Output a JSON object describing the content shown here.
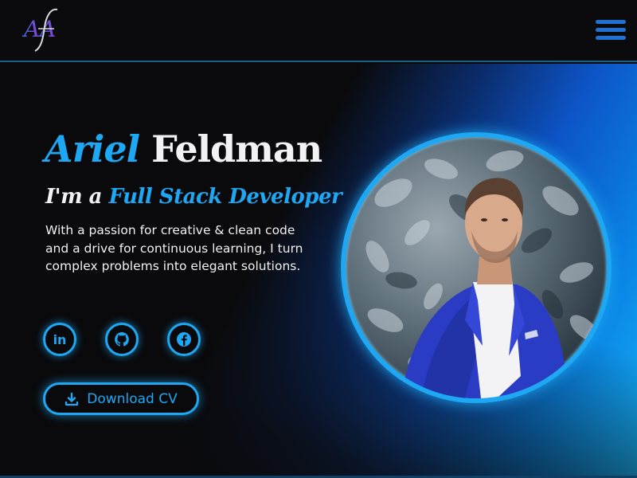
{
  "header": {
    "logo_text": "AF",
    "menu_icon": "hamburger-menu-icon",
    "accent_color": "#1e72d6"
  },
  "hero": {
    "first_name": "Ariel",
    "last_name": "Feldman",
    "role_lead": "I'm a",
    "role_highlight": "Full Stack Developer",
    "bio": "With a passion for creative & clean code and a drive for continuous learning, I turn complex problems into elegant solutions.",
    "accent_color": "#1ea7f2"
  },
  "social": [
    {
      "name": "linkedin",
      "icon": "linkedin-icon"
    },
    {
      "name": "github",
      "icon": "github-icon"
    },
    {
      "name": "facebook",
      "icon": "facebook-icon"
    }
  ],
  "cv_button": {
    "label": "Download CV",
    "icon": "download-icon"
  }
}
